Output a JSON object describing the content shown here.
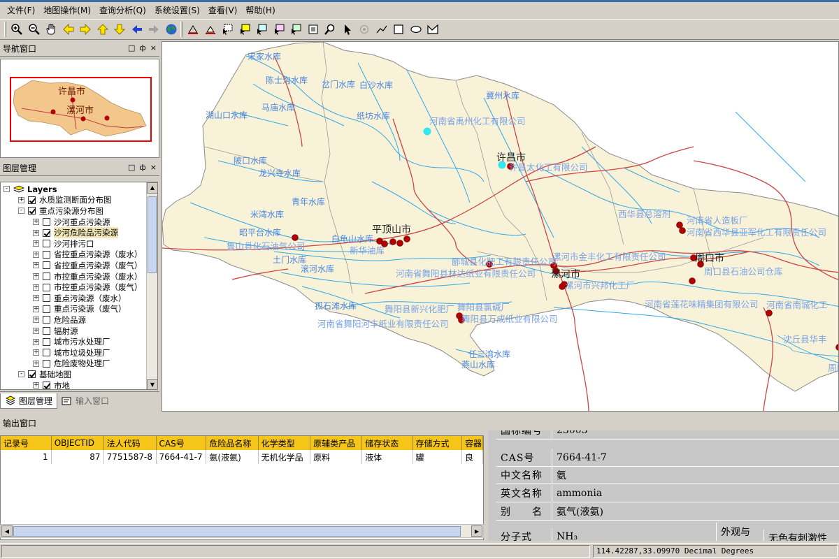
{
  "menubar": {
    "items": [
      "文件(F)",
      "地图操作(M)",
      "查询分析(Q)",
      "系统设置(S)",
      "查看(V)",
      "帮助(H)"
    ]
  },
  "toolbar": {
    "tools": [
      "zoom-in-icon",
      "zoom-out-icon",
      "pan-hand-icon",
      "arrow-left-icon",
      "arrow-right-icon",
      "arrow-up-icon",
      "arrow-down-icon",
      "back-icon",
      "forward-icon",
      "globe-icon",
      "measure-icon",
      "area-icon",
      "select-1-icon",
      "select-2-icon",
      "select-3-icon",
      "select-4-icon",
      "select-5-icon",
      "identify-icon",
      "find-icon",
      "pointer-icon",
      "point-icon",
      "polyline-icon",
      "rectangle-icon",
      "ellipse-icon",
      "polygon-icon"
    ]
  },
  "nav_panel": {
    "title": "导航窗口",
    "labels": [
      "许昌市",
      "漯河市"
    ]
  },
  "layer_panel": {
    "title": "图层管理",
    "rows": [
      {
        "label": "Layers",
        "level": 0,
        "checkbox": false,
        "checked": false,
        "expand": "-",
        "bold": true
      },
      {
        "label": "水质监测断面分布图",
        "level": 1,
        "checkbox": true,
        "checked": true,
        "expand": "+"
      },
      {
        "label": "重点污染源分布图",
        "level": 1,
        "checkbox": true,
        "checked": true,
        "expand": "-"
      },
      {
        "label": "沙河重点污染源",
        "level": 2,
        "checkbox": true,
        "checked": false,
        "expand": "+"
      },
      {
        "label": "沙河危险品污染源",
        "level": 2,
        "checkbox": true,
        "checked": true,
        "expand": "+",
        "selected": true
      },
      {
        "label": "沙河排污口",
        "level": 2,
        "checkbox": true,
        "checked": false,
        "expand": "+"
      },
      {
        "label": "省控重点污染源（废水）",
        "level": 2,
        "checkbox": true,
        "checked": false,
        "expand": "+"
      },
      {
        "label": "省控重点污染源（废气）",
        "level": 2,
        "checkbox": true,
        "checked": false,
        "expand": "+"
      },
      {
        "label": "市控重点污染源（废水）",
        "level": 2,
        "checkbox": true,
        "checked": false,
        "expand": "+"
      },
      {
        "label": "市控重点污染源（废气）",
        "level": 2,
        "checkbox": true,
        "checked": false,
        "expand": "+"
      },
      {
        "label": "重点污染源（废水）",
        "level": 2,
        "checkbox": true,
        "checked": false,
        "expand": "+"
      },
      {
        "label": "重点污染源（废气）",
        "level": 2,
        "checkbox": true,
        "checked": false,
        "expand": "+"
      },
      {
        "label": "危险品源",
        "level": 2,
        "checkbox": true,
        "checked": false,
        "expand": "+"
      },
      {
        "label": "辐射源",
        "level": 2,
        "checkbox": true,
        "checked": false,
        "expand": "+"
      },
      {
        "label": "城市污水处理厂",
        "level": 2,
        "checkbox": true,
        "checked": false,
        "expand": "+"
      },
      {
        "label": "城市垃圾处理厂",
        "level": 2,
        "checkbox": true,
        "checked": false,
        "expand": "+"
      },
      {
        "label": "危险废物处理厂",
        "level": 2,
        "checkbox": true,
        "checked": false,
        "expand": "+"
      },
      {
        "label": "基础地图",
        "level": 1,
        "checkbox": true,
        "checked": true,
        "expand": "-"
      },
      {
        "label": "市地",
        "level": 2,
        "checkbox": true,
        "checked": true,
        "expand": "+"
      }
    ]
  },
  "left_tabs": {
    "layers": "图层管理",
    "input": "输入窗口"
  },
  "map": {
    "reservoirs": [
      "宋家水库",
      "陈士沟水库",
      "岔门水库",
      "白沙水库",
      "马庙水库",
      "纸坊水库",
      "湖山口水库",
      "冀州水库",
      "陂口水库",
      "龙兴寺水库",
      "青年水库",
      "米湾水库",
      "昭平台水库",
      "白龟山水库",
      "土门水库",
      "滚河水库",
      "孤石滩水库",
      "任三湾水库",
      "燕山水库"
    ],
    "cities": [
      "许昌市",
      "平顶山市",
      "漯河市",
      "周口市"
    ],
    "companies": [
      "河南省禹州化工有限公司",
      "许昌太化工有限公司",
      "西华县总溶剂",
      "河南省人造板厂",
      "河南省西华县亚军化工有限责任公司",
      "鲁山县化石油气公司",
      "新华油库",
      "郾城县化肥工有限责任公司",
      "河南省舞阳县林达纸业有限责任公司",
      "漯河市金丰化工有限责任公司",
      "周口县石油公司仓库",
      "漯河市兴邦化工厂",
      "舞阳县新兴化肥厂",
      "舞阳县氯碱厂",
      "河南省舞阳河丰纸业有限责任公司",
      "舞阳县万成纸业有限公司",
      "河南省莲花味精集团有限公司",
      "河南省南城化工",
      "沈丘县华丰",
      "周口"
    ]
  },
  "output": {
    "title": "输出窗口",
    "columns": [
      "记录号",
      "OBJECTID",
      "法人代码",
      "CAS号",
      "危险品名称",
      "化学类型",
      "原辅类产品",
      "储存状态",
      "存储方式",
      "容器"
    ],
    "rows": [
      [
        "1",
        "87",
        "7751587-8",
        "7664-41-7",
        "氨(液氨)",
        "无机化学品",
        "原料",
        "液体",
        "罐",
        "良"
      ]
    ]
  },
  "prop_sheet": {
    "rows": [
      {
        "label": "国标编号",
        "value": "23003"
      },
      {
        "label": "CAS号",
        "value": "7664-41-7"
      },
      {
        "label": "中文名称",
        "value": "氨"
      },
      {
        "label": "英文名称",
        "value": "ammonia"
      },
      {
        "label": "别　　名",
        "value": "氨气(液氨)"
      },
      {
        "label": "分子式",
        "value": "NH₃"
      }
    ],
    "extra_label": "外观与",
    "extra_value": "无色有刺激性"
  },
  "status": {
    "coords": "114.42287,33.09970 Decimal Degrees"
  },
  "colors": {
    "land": "#f7f2d8",
    "boundary": "#8a8a8a",
    "river": "#33a8e6",
    "road": "#cc4444",
    "label_blue": "#4a86e0",
    "city_label": "#222222",
    "marker": "#b00000",
    "header_yellow": "#f5c518"
  }
}
